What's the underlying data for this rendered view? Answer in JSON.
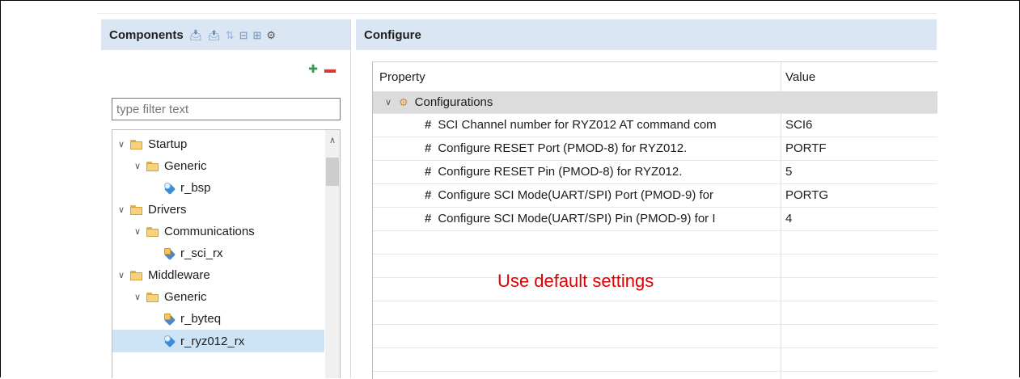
{
  "components": {
    "title": "Components",
    "toolbar_icons": [
      "import-icon",
      "export-icon",
      "sort-icon",
      "collapse-all-icon",
      "expand-all-icon",
      "settings-icon"
    ],
    "filter_placeholder": "type filter text",
    "tree": [
      {
        "label": "Startup",
        "level": 0,
        "type": "folder",
        "expanded": true
      },
      {
        "label": "Generic",
        "level": 1,
        "type": "folder",
        "expanded": true
      },
      {
        "label": "r_bsp",
        "level": 2,
        "type": "component"
      },
      {
        "label": "Drivers",
        "level": 0,
        "type": "folder",
        "expanded": true
      },
      {
        "label": "Communications",
        "level": 1,
        "type": "folder",
        "expanded": true
      },
      {
        "label": "r_sci_rx",
        "level": 2,
        "type": "package"
      },
      {
        "label": "Middleware",
        "level": 0,
        "type": "folder",
        "expanded": true
      },
      {
        "label": "Generic",
        "level": 1,
        "type": "folder",
        "expanded": true
      },
      {
        "label": "r_byteq",
        "level": 2,
        "type": "package"
      },
      {
        "label": "r_ryz012_rx",
        "level": 2,
        "type": "component",
        "selected": true
      }
    ]
  },
  "configure": {
    "title": "Configure",
    "columns": {
      "property": "Property",
      "value": "Value"
    },
    "group": "Configurations",
    "rows": [
      {
        "property": "SCI Channel number for RYZ012 AT command com",
        "value": "SCI6"
      },
      {
        "property": "Configure RESET Port (PMOD-8) for RYZ012.",
        "value": "PORTF"
      },
      {
        "property": "Configure RESET Pin (PMOD-8) for RYZ012.",
        "value": "5"
      },
      {
        "property": "Configure SCI Mode(UART/SPI) Port (PMOD-9) for",
        "value": "PORTG"
      },
      {
        "property": "Configure SCI Mode(UART/SPI) Pin (PMOD-9) for I",
        "value": "4"
      }
    ],
    "annotation": "Use default settings"
  },
  "colors": {
    "header_bg": "#dbe6f4",
    "selected_bg": "#cde4f7",
    "annotation": "#e10000",
    "group_bg": "#dcdcdc"
  }
}
